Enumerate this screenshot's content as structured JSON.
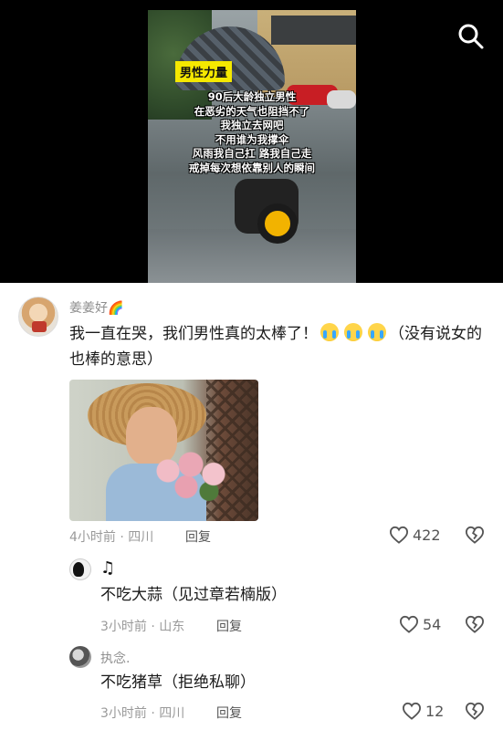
{
  "video": {
    "tag": "男性力量",
    "lines": [
      "90后大龄独立男性",
      "在恶劣的天气也阻挡不了",
      "我独立去网吧",
      "不用谁为我撑伞",
      "风雨我自己扛 路我自己走",
      "戒掉每次想依靠别人的瞬间"
    ]
  },
  "icons": {
    "search": "search-icon",
    "like": "heart-outline-icon",
    "dislike": "broken-heart-icon",
    "note": "music-note-icon",
    "emoji": "loudly-crying-face-icon"
  },
  "main_comment": {
    "username": "姜姜好🌈",
    "text_before": "我一直在哭，我们男性真的太棒了！",
    "text_after": "（没有说女的也棒的意思）",
    "time_location": "4小时前 · 四川",
    "reply_label": "回复",
    "likes": "422"
  },
  "replies": [
    {
      "username": "♫",
      "text": "不吃大蒜（见过章若楠版）",
      "time_location": "3小时前 · 山东",
      "reply_label": "回复",
      "likes": "54"
    },
    {
      "username": "执念.",
      "text": "不吃猪草（拒绝私聊）",
      "time_location": "3小时前 · 四川",
      "reply_label": "回复",
      "likes": "12"
    }
  ],
  "colors": {
    "text_primary": "#1a1a1a",
    "text_secondary": "#9a9a9a",
    "video_bg": "#000000",
    "caption_tag": "#f5e800"
  }
}
